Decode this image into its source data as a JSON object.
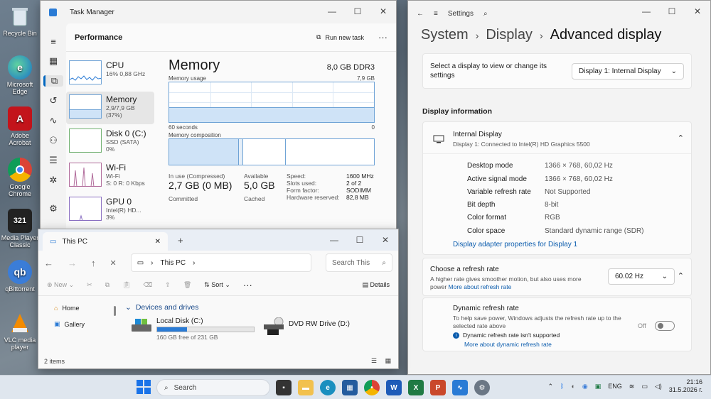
{
  "desktop": {
    "icons": [
      {
        "label": "Recycle Bin"
      },
      {
        "label": "Microsoft Edge"
      },
      {
        "label": "Adobe Acrobat"
      },
      {
        "label": "Google Chrome"
      },
      {
        "label": "Media Player Classic"
      },
      {
        "label": "qBittorrent"
      },
      {
        "label": "VLC media player"
      }
    ]
  },
  "task_manager": {
    "title": "Task Manager",
    "section": "Performance",
    "run_new_task": "Run new task",
    "items": [
      {
        "name": "CPU",
        "sub1": "16% 0,88 GHz",
        "sub2": ""
      },
      {
        "name": "Memory",
        "sub1": "2,9/7,9 GB (37%)",
        "sub2": ""
      },
      {
        "name": "Disk 0 (C:)",
        "sub1": "SSD (SATA)",
        "sub2": "0%"
      },
      {
        "name": "Wi-Fi",
        "sub1": "Wi-Fi",
        "sub2": "S: 0 R: 0 Kbps"
      },
      {
        "name": "GPU 0",
        "sub1": "Intel(R) HD...",
        "sub2": "3%"
      }
    ],
    "memory": {
      "title": "Memory",
      "total": "8,0 GB DDR3",
      "usage_label": "Memory usage",
      "usage_max": "7,9 GB",
      "usage_fraction": 0.37,
      "time_left": "60 seconds",
      "time_right": "0",
      "composition_label": "Memory composition",
      "in_use_label": "In use (Compressed)",
      "in_use_value": "2,7 GB (0 MB)",
      "available_label": "Available",
      "available_value": "5,0 GB",
      "committed_label": "Committed",
      "cached_label": "Cached",
      "specs": [
        {
          "k": "Speed:",
          "v": "1600 MHz"
        },
        {
          "k": "Slots used:",
          "v": "2 of 2"
        },
        {
          "k": "Form factor:",
          "v": "SODIMM"
        },
        {
          "k": "Hardware reserved:",
          "v": "82,8 MB"
        }
      ]
    }
  },
  "settings": {
    "title": "Settings",
    "breadcrumb": [
      "System",
      "Display",
      "Advanced display"
    ],
    "select_display_text": "Select a display to view or change its settings",
    "display_selected": "Display 1: Internal Display",
    "display_info_header": "Display information",
    "internal_display": "Internal Display",
    "internal_display_sub": "Display 1: Connected to Intel(R) HD Graphics 5500",
    "rows": [
      {
        "k": "Desktop mode",
        "v": "1366 × 768, 60,02 Hz"
      },
      {
        "k": "Active signal mode",
        "v": "1366 × 768, 60,02 Hz"
      },
      {
        "k": "Variable refresh rate",
        "v": "Not Supported"
      },
      {
        "k": "Bit depth",
        "v": "8-bit"
      },
      {
        "k": "Color format",
        "v": "RGB"
      },
      {
        "k": "Color space",
        "v": "Standard dynamic range (SDR)"
      }
    ],
    "adapter_link": "Display adapter properties for Display 1",
    "refresh_title": "Choose a refresh rate",
    "refresh_desc": "A higher rate gives smoother motion, but also uses more power",
    "refresh_link": "More about refresh rate",
    "refresh_value": "60.02 Hz",
    "dyn_title": "Dynamic refresh rate",
    "dyn_desc": "To help save power, Windows adjusts the refresh rate up to the selected rate above",
    "dyn_state": "Off",
    "dyn_warning": "Dynamic refresh rate isn't supported",
    "dyn_link": "More about dynamic refresh rate"
  },
  "explorer": {
    "tab_title": "This PC",
    "address": "This PC",
    "search_placeholder": "Search This",
    "new_label": "New",
    "sort_label": "Sort",
    "details_label": "Details",
    "nav_home": "Home",
    "nav_gallery": "Gallery",
    "section": "Devices and drives",
    "drive_c_name": "Local Disk (C:)",
    "drive_c_free": "160 GB free of 231 GB",
    "drive_c_used_fraction": 0.31,
    "drive_d_name": "DVD RW Drive (D:)",
    "status": "2 items"
  },
  "taskbar": {
    "search_label": "Search",
    "lang": "ENG",
    "time": "21:16",
    "date": "31.5.2026 г."
  },
  "colors": {
    "accent": "#0067c0",
    "mem_fill": "#cfe3f7",
    "mem_line": "#6fa3d6"
  }
}
